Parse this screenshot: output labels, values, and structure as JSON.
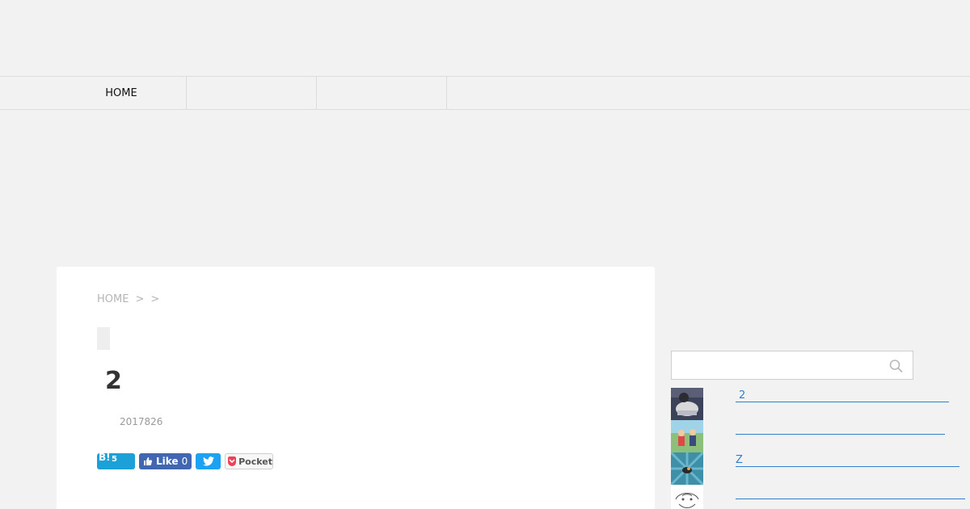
{
  "nav": {
    "items": [
      {
        "label": "HOME"
      },
      {
        "label": ""
      },
      {
        "label": ""
      }
    ]
  },
  "article": {
    "breadcrumb": [
      "HOME",
      ">",
      ">"
    ],
    "title": "2",
    "date": "2017826",
    "share": {
      "hatena_label": "B!",
      "hatena_count": "5",
      "facebook_label": "Like",
      "facebook_count": "0",
      "pocket_label": "Pocket"
    }
  },
  "sidebar": {
    "search": {
      "placeholder": "",
      "value": ""
    },
    "related": [
      {
        "label": "2"
      },
      {
        "label": ""
      },
      {
        "label": "Z"
      },
      {
        "label": ""
      }
    ]
  },
  "colors": {
    "background": "#f2f2f2",
    "card": "#ffffff",
    "link": "#2f7fcc",
    "hatena": "#1ba1d8",
    "facebook": "#4267b2",
    "twitter": "#1da1f2",
    "pocket": "#ef4056"
  }
}
